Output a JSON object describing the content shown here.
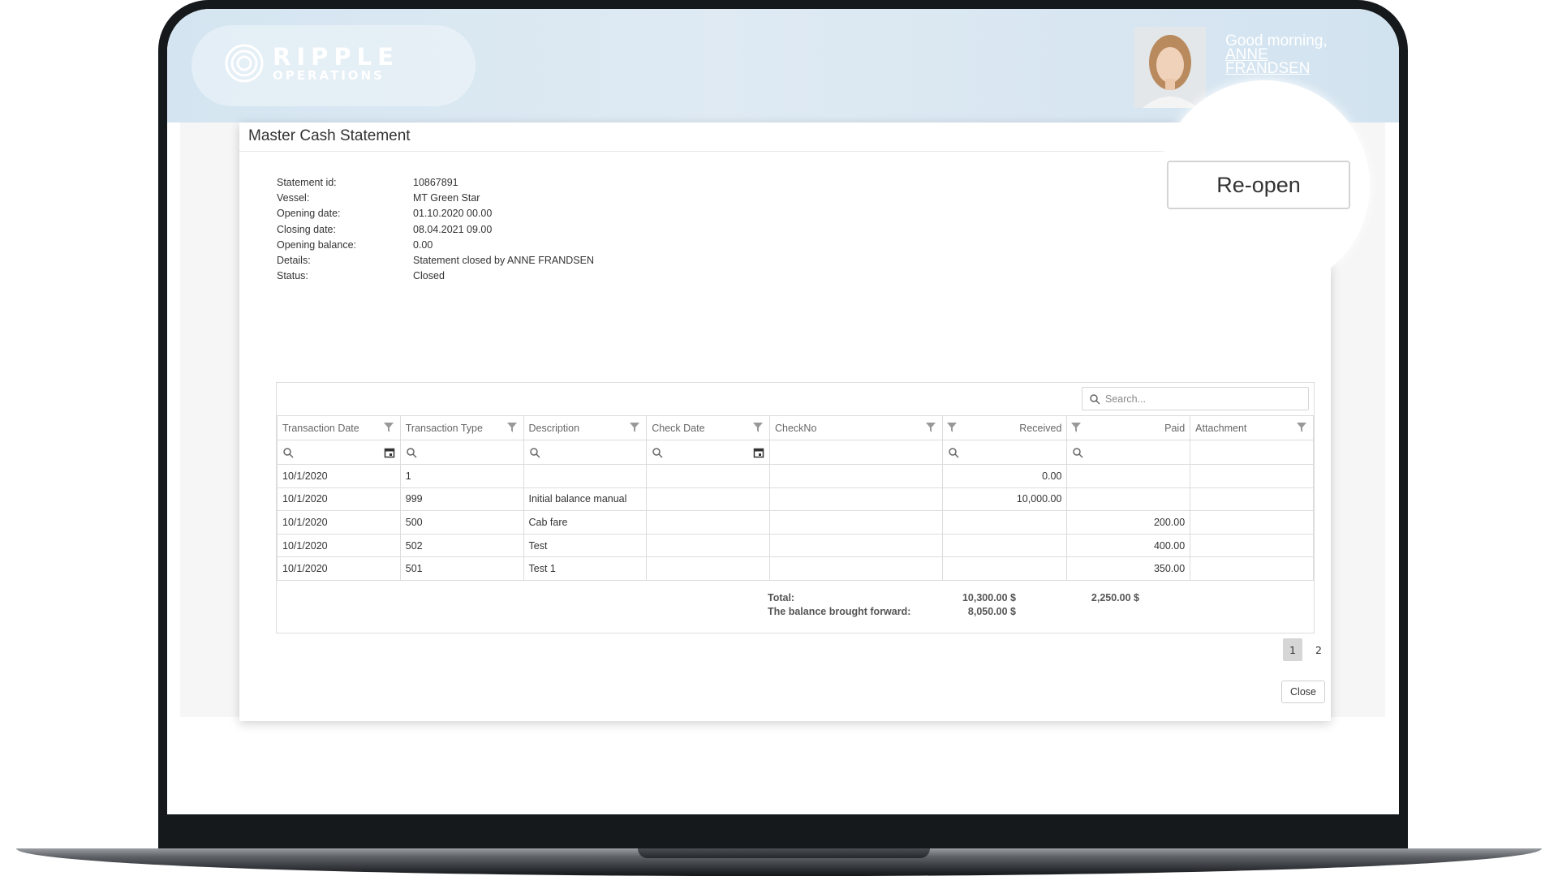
{
  "brand": {
    "name": "RIPPLE",
    "sub": "OPERATIONS"
  },
  "user": {
    "greeting": "Good morning,",
    "first": "ANNE",
    "last": "FRANDSEN"
  },
  "modal": {
    "title": "Master Cash Statement"
  },
  "statement": [
    {
      "label": "Statement id:",
      "value": "10867891"
    },
    {
      "label": "Vessel:",
      "value": "MT Green Star"
    },
    {
      "label": "Opening date:",
      "value": "01.10.2020 00.00"
    },
    {
      "label": "Closing date:",
      "value": "08.04.2021 09.00"
    },
    {
      "label": "Opening balance:",
      "value": "0.00"
    },
    {
      "label": "Details:",
      "value": "Statement closed by ANNE FRANDSEN"
    },
    {
      "label": "Status:",
      "value": "Closed"
    }
  ],
  "grid": {
    "search_placeholder": "Search...",
    "columns": [
      "Transaction Date",
      "Transaction Type",
      "Description",
      "Check Date",
      "CheckNo",
      "Received",
      "Paid",
      "Attachment"
    ],
    "rows": [
      [
        "10/1/2020",
        "1",
        "",
        "",
        "",
        "0.00",
        "",
        ""
      ],
      [
        "10/1/2020",
        "999",
        "Initial balance manual",
        "",
        "",
        "10,000.00",
        "",
        ""
      ],
      [
        "10/1/2020",
        "500",
        "Cab fare",
        "",
        "",
        "",
        "200.00",
        ""
      ],
      [
        "10/1/2020",
        "502",
        "Test",
        "",
        "",
        "",
        "400.00",
        ""
      ],
      [
        "10/1/2020",
        "501",
        "Test 1",
        "",
        "",
        "",
        "350.00",
        ""
      ]
    ],
    "totals": {
      "total_label": "Total:",
      "balance_label": "The balance brought forward:",
      "received_total": "10,300.00 $",
      "balance_value": "8,050.00 $",
      "paid_total": "2,250.00 $"
    }
  },
  "pager": {
    "pages": [
      "1",
      "2"
    ],
    "active": "1"
  },
  "buttons": {
    "close": "Close",
    "reopen": "Re-open"
  },
  "colors": {
    "header": "#d4e5f1",
    "border": "#dcdcdc",
    "active_page": "#d6d6d6"
  }
}
